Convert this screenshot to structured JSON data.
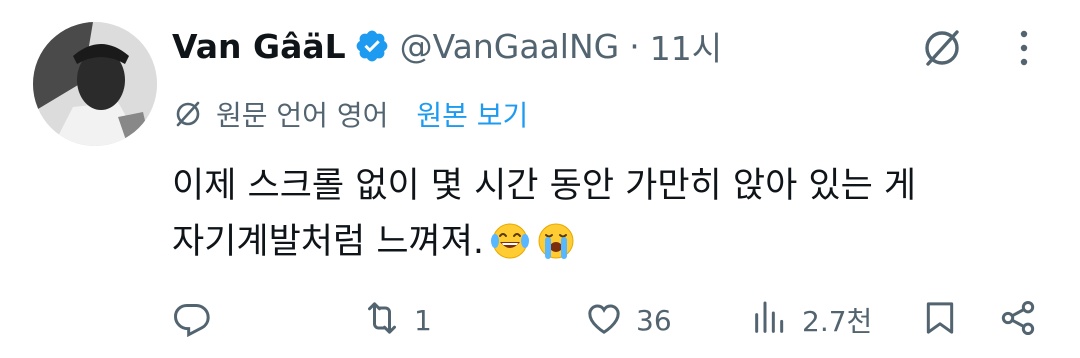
{
  "author": {
    "name": "Van GâäL",
    "handle": "@VanGaalNG",
    "separator": "·",
    "time": "11시",
    "verified": true
  },
  "icons": {
    "avatar": "profile-photo",
    "verified": "verified-badge-icon",
    "grok": "grok-icon",
    "more": "more-dots-icon",
    "translate": "translate-icon",
    "reply": "reply-icon",
    "repost": "repost-icon",
    "like": "heart-icon",
    "views": "views-bar-chart-icon",
    "bookmark": "bookmark-icon",
    "share": "share-icon",
    "emoji_1": "face-with-tears-of-joy",
    "emoji_2": "loudly-crying-face"
  },
  "translation": {
    "source_label": "원문 언어 영어",
    "show_original": "원본 보기"
  },
  "post": {
    "line_1": "이제 스크롤 없이 몇 시간 동안 가만히 앉아 있는 게",
    "line_2": "자기계발처럼 느껴져."
  },
  "metrics": {
    "reposts": "1",
    "likes": "36",
    "views": "2.7천"
  },
  "colors": {
    "accent": "#1d9bf0",
    "text": "#0f1419",
    "muted": "#536471"
  }
}
